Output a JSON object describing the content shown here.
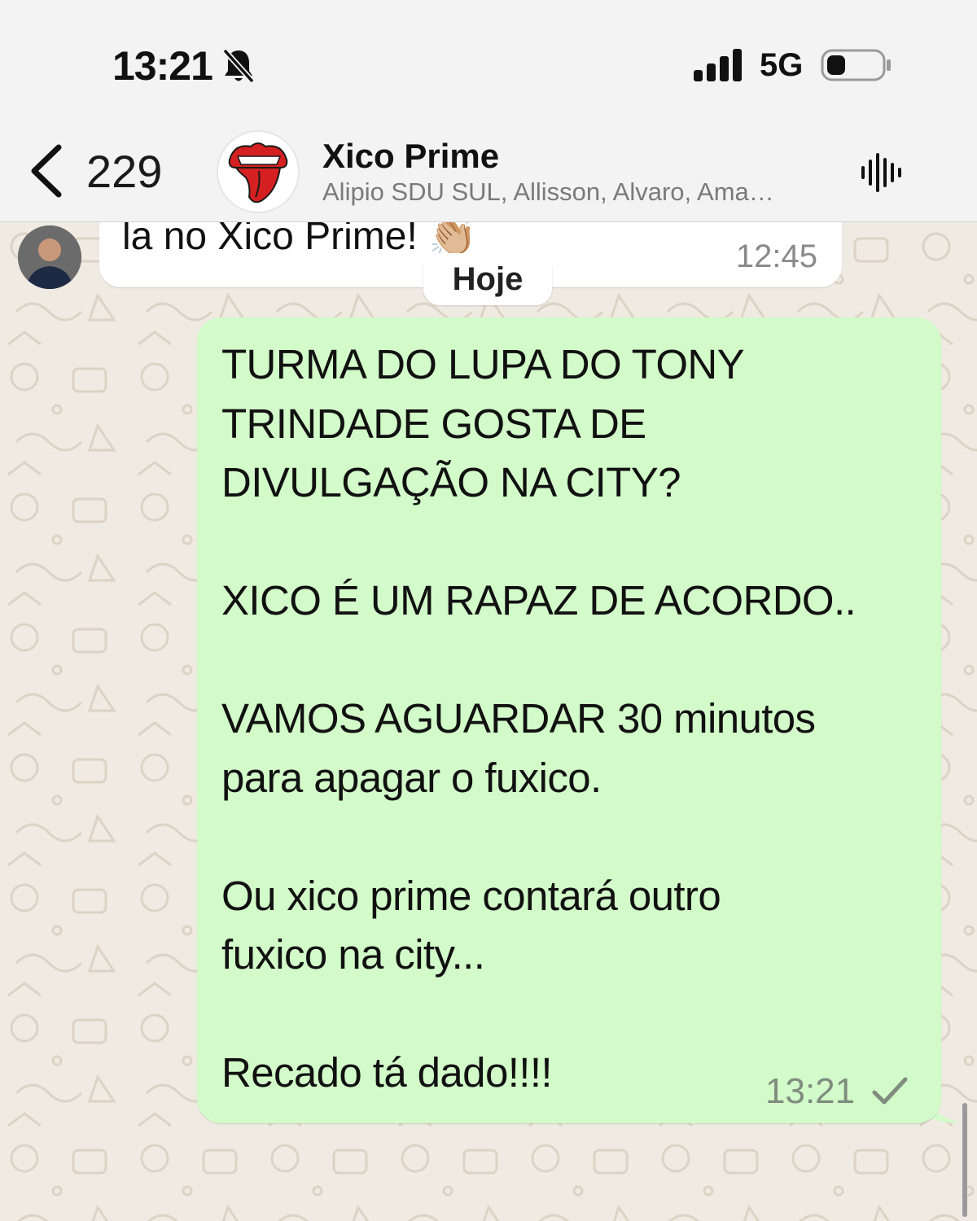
{
  "status_bar": {
    "time": "13:21",
    "network": "5G",
    "icons": [
      "bell-slash-icon",
      "signal-icon",
      "battery-icon"
    ]
  },
  "header": {
    "back_count": "229",
    "title": "Xico Prime",
    "members": "Alipio SDU SUL, Allisson, Alvaro, Ama…",
    "icons": [
      "chevron-left-icon",
      "rolling-stones-tongue-logo",
      "voice-waveform-icon"
    ]
  },
  "chat": {
    "date_separator": "Hoje",
    "incoming": {
      "text": "la no Xico Prime! 👏🏼",
      "time": "12:45"
    },
    "outgoing": {
      "lines": [
        "TURMA DO LUPA DO TONY",
        "TRINDADE GOSTA DE",
        "DIVULGAÇÃO NA CITY?",
        "",
        "XICO É UM RAPAZ DE ACORDO..",
        "",
        "VAMOS AGUARDAR 30 minutos",
        "para apagar o fuxico.",
        "",
        "Ou xico prime contará outro",
        "fuxico na city...",
        "",
        "Recado tá dado!!!!"
      ],
      "time": "13:21",
      "status_icon": "single-check-icon"
    }
  },
  "colors": {
    "outgoing_bubble": "#d2fbc9",
    "incoming_bubble": "#ffffff",
    "wallpaper": "#efeae2",
    "header": "#f3f3f3"
  }
}
